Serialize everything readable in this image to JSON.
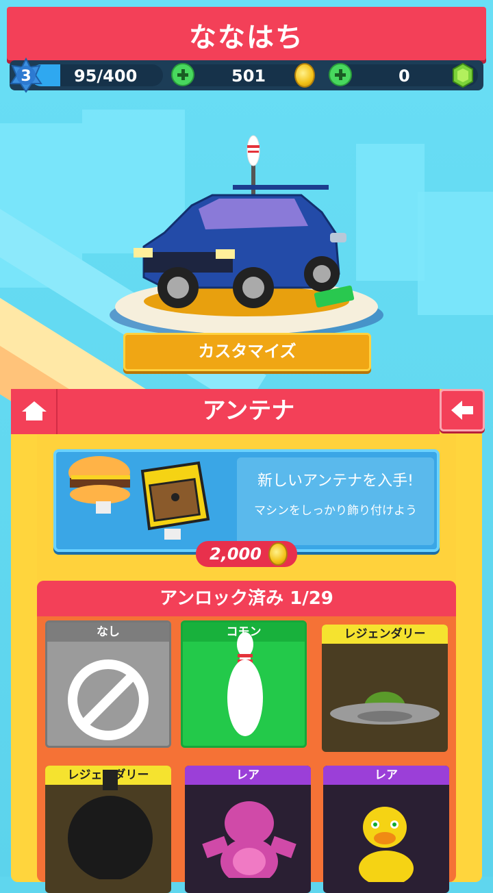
{
  "header": {
    "title": "ななはち"
  },
  "stats": {
    "level": "3",
    "xp": "95/400",
    "coins": "501",
    "gems": "0"
  },
  "stage": {
    "customize_label": "カスタマイズ"
  },
  "panel": {
    "title": "アンテナ",
    "offer": {
      "title": "新しいアンテナを入手!",
      "description": "マシンをしっかり飾り付けよう",
      "price": "2,000"
    },
    "grid_title": "アンロック済み 1/29",
    "items": [
      {
        "label": "なし",
        "color": "#8e8e8e"
      },
      {
        "label": "コモン",
        "color": "#23c94a"
      },
      {
        "label": "レジェンダリー",
        "color": "#f5e32f"
      },
      {
        "label": "レジェンダリー",
        "color": "#f5e32f"
      },
      {
        "label": "レア",
        "color": "#9b3fd8"
      },
      {
        "label": "レア",
        "color": "#9b3fd8"
      }
    ]
  },
  "colors": {
    "accent": "#f34058",
    "panel": "#ffd53d",
    "customize": "#f0a614"
  }
}
